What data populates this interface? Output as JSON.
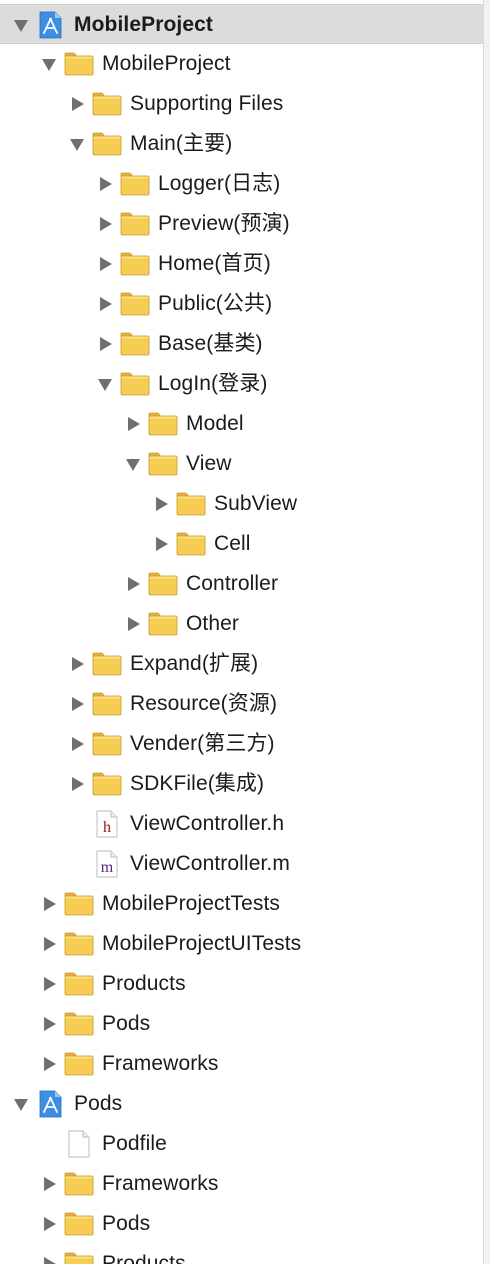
{
  "navigator": {
    "rows": [
      {
        "label": "MobileProject",
        "level": 0,
        "disclosure": "expanded",
        "icon": "xcode-project-icon",
        "selected": true,
        "bold": true
      },
      {
        "label": "MobileProject",
        "level": 1,
        "disclosure": "expanded",
        "icon": "folder-icon"
      },
      {
        "label": "Supporting Files",
        "level": 2,
        "disclosure": "collapsed",
        "icon": "folder-icon"
      },
      {
        "label": "Main(主要)",
        "level": 2,
        "disclosure": "expanded",
        "icon": "folder-icon"
      },
      {
        "label": "Logger(日志)",
        "level": 3,
        "disclosure": "collapsed",
        "icon": "folder-icon"
      },
      {
        "label": "Preview(预演)",
        "level": 3,
        "disclosure": "collapsed",
        "icon": "folder-icon"
      },
      {
        "label": "Home(首页)",
        "level": 3,
        "disclosure": "collapsed",
        "icon": "folder-icon"
      },
      {
        "label": "Public(公共)",
        "level": 3,
        "disclosure": "collapsed",
        "icon": "folder-icon"
      },
      {
        "label": "Base(基类)",
        "level": 3,
        "disclosure": "collapsed",
        "icon": "folder-icon"
      },
      {
        "label": "LogIn(登录)",
        "level": 3,
        "disclosure": "expanded",
        "icon": "folder-icon"
      },
      {
        "label": "Model",
        "level": 4,
        "disclosure": "collapsed",
        "icon": "folder-icon"
      },
      {
        "label": "View",
        "level": 4,
        "disclosure": "expanded",
        "icon": "folder-icon"
      },
      {
        "label": "SubView",
        "level": 5,
        "disclosure": "collapsed",
        "icon": "folder-icon"
      },
      {
        "label": "Cell",
        "level": 5,
        "disclosure": "collapsed",
        "icon": "folder-icon"
      },
      {
        "label": "Controller",
        "level": 4,
        "disclosure": "collapsed",
        "icon": "folder-icon"
      },
      {
        "label": "Other",
        "level": 4,
        "disclosure": "collapsed",
        "icon": "folder-icon"
      },
      {
        "label": "Expand(扩展)",
        "level": 2,
        "disclosure": "collapsed",
        "icon": "folder-icon"
      },
      {
        "label": "Resource(资源)",
        "level": 2,
        "disclosure": "collapsed",
        "icon": "folder-icon"
      },
      {
        "label": "Vender(第三方)",
        "level": 2,
        "disclosure": "collapsed",
        "icon": "folder-icon"
      },
      {
        "label": "SDKFile(集成)",
        "level": 2,
        "disclosure": "collapsed",
        "icon": "folder-icon"
      },
      {
        "label": "ViewController.h",
        "level": 2,
        "disclosure": "none",
        "icon": "header-file-icon",
        "file_letter": "h"
      },
      {
        "label": "ViewController.m",
        "level": 2,
        "disclosure": "none",
        "icon": "objc-file-icon",
        "file_letter": "m"
      },
      {
        "label": "MobileProjectTests",
        "level": 1,
        "disclosure": "collapsed",
        "icon": "folder-icon"
      },
      {
        "label": "MobileProjectUITests",
        "level": 1,
        "disclosure": "collapsed",
        "icon": "folder-icon"
      },
      {
        "label": "Products",
        "level": 1,
        "disclosure": "collapsed",
        "icon": "folder-icon"
      },
      {
        "label": "Pods",
        "level": 1,
        "disclosure": "collapsed",
        "icon": "folder-icon"
      },
      {
        "label": "Frameworks",
        "level": 1,
        "disclosure": "collapsed",
        "icon": "folder-icon"
      },
      {
        "label": "Pods",
        "level": 0,
        "disclosure": "expanded",
        "icon": "xcode-project-icon"
      },
      {
        "label": "Podfile",
        "level": 1,
        "disclosure": "none",
        "icon": "document-icon"
      },
      {
        "label": "Frameworks",
        "level": 1,
        "disclosure": "collapsed",
        "icon": "folder-icon"
      },
      {
        "label": "Pods",
        "level": 1,
        "disclosure": "collapsed",
        "icon": "folder-icon"
      },
      {
        "label": "Products",
        "level": 1,
        "disclosure": "collapsed",
        "icon": "folder-icon"
      }
    ]
  },
  "colors": {
    "selection_background": "#dcdcdc",
    "folder_body": "#f6cc53",
    "folder_tab": "#e7b43a",
    "folder_outline": "#c99a2c",
    "disclosure_triangle": "#6f6f6f",
    "project_icon": "#3c8fe3",
    "header_letter": "#8b1a1a",
    "objc_letter": "#5a2a82"
  }
}
